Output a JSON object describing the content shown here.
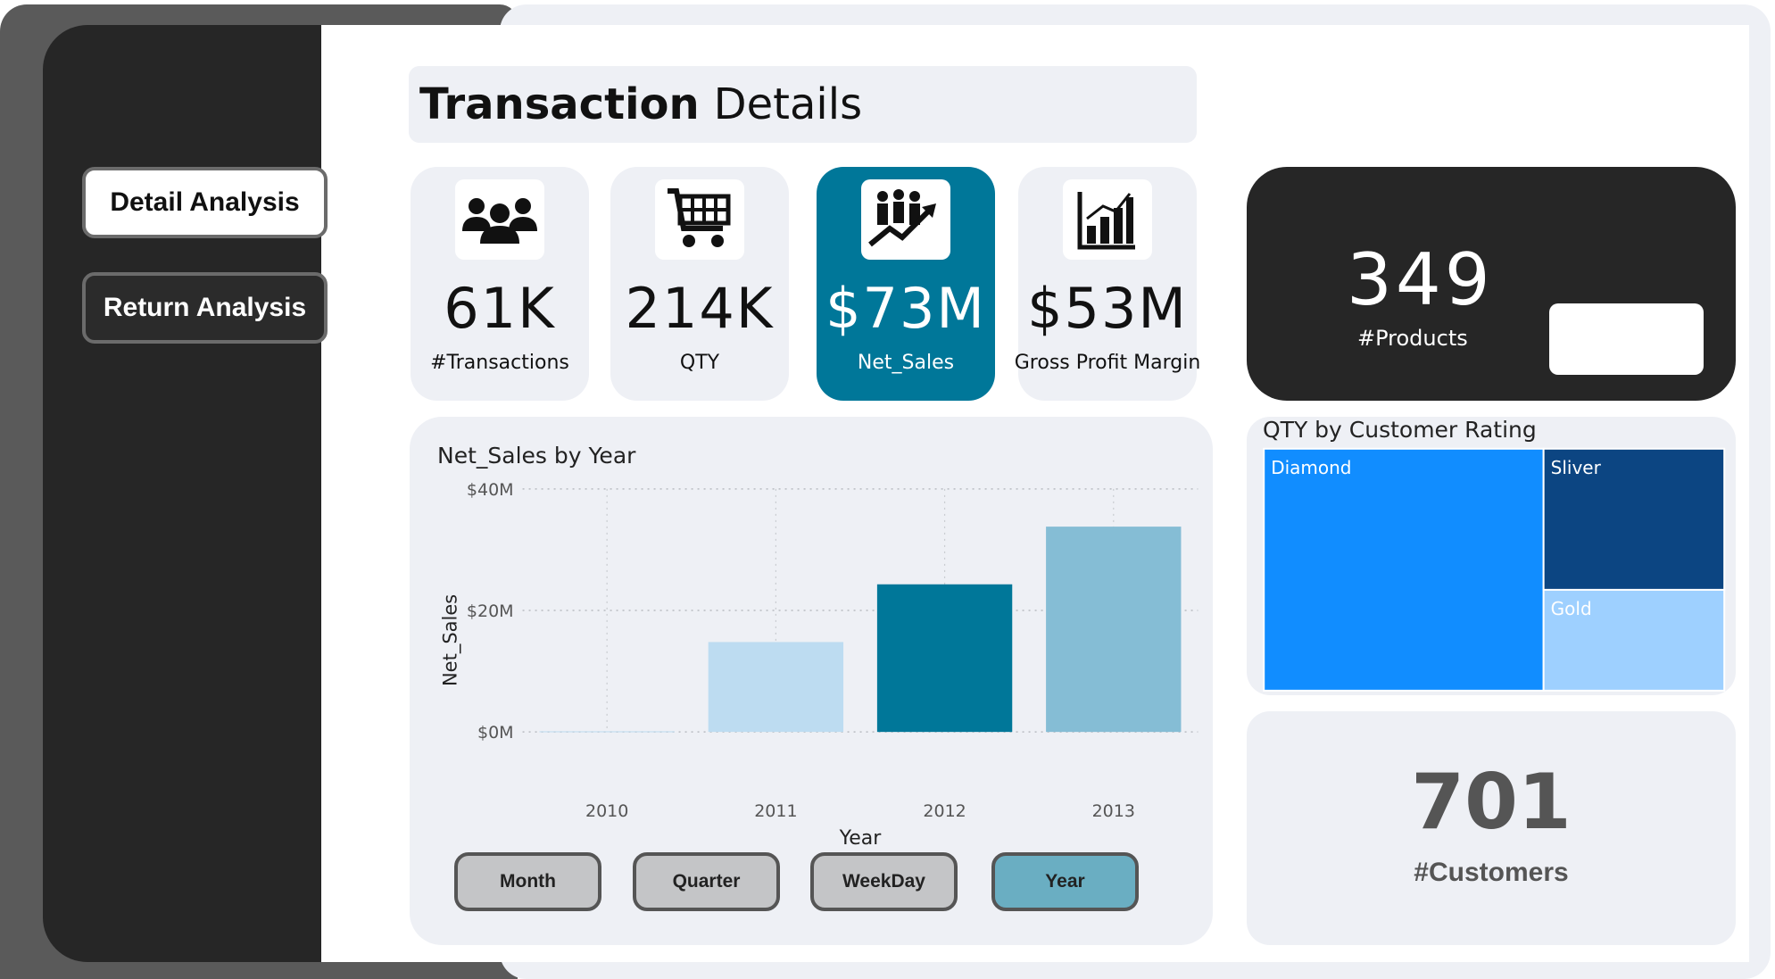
{
  "sidebar": {
    "items": [
      {
        "label": "Detail Analysis",
        "active": true
      },
      {
        "label": "Return Analysis",
        "active": false
      }
    ]
  },
  "header": {
    "title_bold": "Transaction",
    "title_rest": "Details"
  },
  "kpis": [
    {
      "value": "61K",
      "label": "#Transactions",
      "icon": "people-group-icon"
    },
    {
      "value": "214K",
      "label": "QTY",
      "icon": "shopping-cart-icon"
    },
    {
      "value": "$73M",
      "label": "Net_Sales",
      "icon": "growth-people-icon"
    },
    {
      "value": "$53M",
      "label": "Gross Profit Margin",
      "icon": "bar-chart-icon"
    }
  ],
  "products": {
    "value": "349",
    "label": "#Products"
  },
  "customers": {
    "value": "701",
    "label": "#Customers"
  },
  "period_buttons": [
    {
      "label": "Month"
    },
    {
      "label": "Quarter"
    },
    {
      "label": "WeekDay"
    },
    {
      "label": "Year",
      "selected": true
    }
  ],
  "colors": {
    "sidebar": "#262626",
    "accent": "#007799",
    "card_bg": "#eef0f5",
    "year_button": "#6aaec2"
  },
  "chart_data": [
    {
      "type": "bar",
      "title": "Net_Sales by Year",
      "xlabel": "Year",
      "ylabel": "Net_Sales",
      "categories": [
        "2010",
        "2011",
        "2012",
        "2013"
      ],
      "values": [
        0.1,
        14.8,
        24.3,
        33.8
      ],
      "value_unit": "$M",
      "bar_colors": [
        "#bddcf1",
        "#bddcf1",
        "#007799",
        "#85bdd5"
      ],
      "ylim": [
        0,
        40
      ],
      "yticks": [
        {
          "value": 0,
          "label": "$0M"
        },
        {
          "value": 20,
          "label": "$20M"
        },
        {
          "value": 40,
          "label": "$40M"
        }
      ],
      "grid": true
    },
    {
      "type": "treemap",
      "title": "QTY by Customer Rating",
      "items": [
        {
          "label": "Diamond",
          "value": 130,
          "color": "#118dff"
        },
        {
          "label": "Sliver",
          "value": 49,
          "color": "#0c4582"
        },
        {
          "label": "Gold",
          "value": 35,
          "color": "#9ed0ff"
        }
      ]
    }
  ]
}
